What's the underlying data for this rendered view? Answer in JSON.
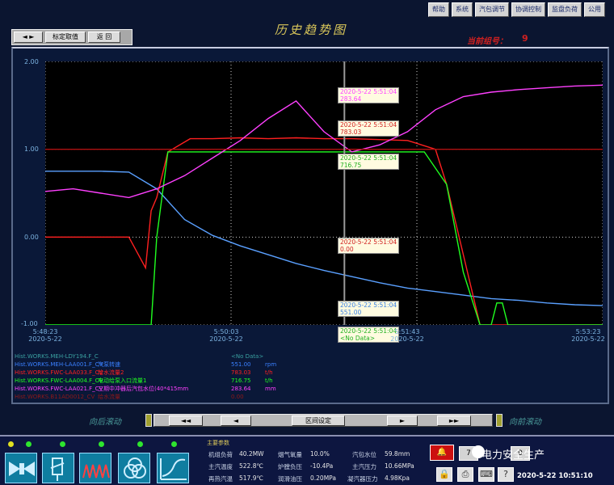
{
  "topnav": [
    "帮助",
    "系统",
    "汽包调节",
    "协调控制",
    "监盘负荷",
    "公用"
  ],
  "toolbar": {
    "nav": "◄ ►",
    "bookmark": "标定取值",
    "back": "返 回"
  },
  "title": "历史趋势图",
  "group": {
    "label": "当前组号：",
    "value": "9"
  },
  "chart_data": {
    "type": "line",
    "ylim": [
      -1.0,
      2.0
    ],
    "yticks": [
      "2.00",
      "1.00",
      "0.00",
      "-1.00"
    ],
    "xticks": [
      {
        "time": "5:48:23",
        "date": "2020-5-22"
      },
      {
        "time": "5:50:03",
        "date": "2020-5-22"
      },
      {
        "time": "5:51:43",
        "date": "2020-5-22"
      },
      {
        "time": "5:53:23",
        "date": "2020-5-22"
      }
    ],
    "cursor_time": "2020-5-22 5:51:04",
    "series": [
      {
        "name": "Hist.WORKS.MEH-LAA001.F_CV",
        "color": "#5aa0ff",
        "x": [
          0,
          0.05,
          0.1,
          0.15,
          0.2,
          0.25,
          0.3,
          0.35,
          0.4,
          0.45,
          0.5,
          0.55,
          0.6,
          0.65,
          0.7,
          0.75,
          0.8,
          0.85,
          0.9,
          0.95,
          1.0
        ],
        "y": [
          0.75,
          0.75,
          0.75,
          0.74,
          0.55,
          0.2,
          0.02,
          -0.1,
          -0.2,
          -0.3,
          -0.38,
          -0.45,
          -0.52,
          -0.58,
          -0.62,
          -0.66,
          -0.7,
          -0.72,
          -0.75,
          -0.77,
          -0.78
        ]
      },
      {
        "name": "Hist.WORKS.FWC-LAA033.F_CV",
        "color": "#ff2020",
        "x": [
          0,
          0.05,
          0.1,
          0.15,
          0.18,
          0.19,
          0.2,
          0.22,
          0.26,
          0.3,
          0.35,
          0.4,
          0.45,
          0.5,
          0.55,
          0.6,
          0.65,
          0.7,
          0.72,
          0.75,
          0.78,
          0.8,
          1.0
        ],
        "y": [
          0.0,
          0.0,
          0.0,
          0.0,
          -0.35,
          0.3,
          0.45,
          0.97,
          1.12,
          1.12,
          1.13,
          1.12,
          1.13,
          1.12,
          1.12,
          1.11,
          1.1,
          1.0,
          0.6,
          -0.2,
          -1.0,
          -1.0,
          -1.0
        ]
      },
      {
        "name": "Hist.WORKS.FWC-LAA004.F_CV",
        "color": "#20ff20",
        "x": [
          0,
          0.05,
          0.1,
          0.15,
          0.19,
          0.2,
          0.22,
          0.3,
          0.4,
          0.5,
          0.6,
          0.68,
          0.72,
          0.75,
          0.78,
          0.8,
          0.81,
          0.82,
          0.83,
          1.0
        ],
        "y": [
          -1.0,
          -1.0,
          -1.0,
          -1.0,
          -1.0,
          0.0,
          0.97,
          0.97,
          0.97,
          0.97,
          0.97,
          0.97,
          0.6,
          -0.4,
          -1.0,
          -1.0,
          -0.75,
          -0.75,
          -1.0,
          -1.0
        ]
      },
      {
        "name": "Hist.WORKS.FWC-LAA021.F_CV",
        "color": "#ff40ff",
        "x": [
          0,
          0.05,
          0.1,
          0.15,
          0.2,
          0.25,
          0.3,
          0.35,
          0.4,
          0.45,
          0.5,
          0.55,
          0.6,
          0.65,
          0.7,
          0.75,
          0.8,
          0.85,
          0.9,
          0.95,
          1.0
        ],
        "y": [
          0.52,
          0.55,
          0.5,
          0.45,
          0.55,
          0.7,
          0.9,
          1.1,
          1.35,
          1.55,
          1.2,
          0.97,
          1.05,
          1.2,
          1.45,
          1.6,
          1.65,
          1.68,
          1.7,
          1.72,
          1.73
        ]
      },
      {
        "name": "Hist.WORKS.Ref",
        "color": "#b01010",
        "x": [
          0,
          1.0
        ],
        "y": [
          1.0,
          1.0
        ]
      }
    ]
  },
  "callouts": [
    {
      "time": "2020-5-22 5:51:04",
      "value": "283.64",
      "color": "#ff40ff"
    },
    {
      "time": "2020-5-22 5:51:04",
      "value": "783.03",
      "color": "#d02020"
    },
    {
      "time": "2020-5-22 5:51:04",
      "value": "716.75",
      "color": "#20b020"
    },
    {
      "time": "2020-5-22 5:51:04",
      "value": "0.00",
      "color": "#d02020"
    },
    {
      "time": "2020-5-22 5:51:04",
      "value": "551.00",
      "color": "#3a80e0"
    },
    {
      "time": "2020-5-22 5:51:04",
      "value": "<No Data>",
      "color": "#20b020"
    }
  ],
  "legend": [
    {
      "tag": "Hist.WORKS.MEH-LDY194.F_C",
      "desc": "",
      "value": "<No Data>",
      "unit": "",
      "color": "#3aa0a0"
    },
    {
      "tag": "Hist.WORKS.MEH-LAA001.F_CV",
      "desc": "汽泵转速",
      "value": "551.00",
      "unit": "rpm",
      "color": "#3a80ff"
    },
    {
      "tag": "Hist.WORKS.FWC-LAA033.F_CV",
      "desc": "给水流量2",
      "value": "783.03",
      "unit": "t/h",
      "color": "#ff2020"
    },
    {
      "tag": "Hist.WORKS.FWC-LAA004.F_CV",
      "desc": "电动给泵入口流量1",
      "value": "716.75",
      "unit": "t/h",
      "color": "#20ff20"
    },
    {
      "tag": "Hist.WORKS.FWC-LAA021.F_CV",
      "desc": "三期中冲器后汽包水位(40*415mm",
      "value": "283.64",
      "unit": "mm",
      "color": "#ff40ff"
    },
    {
      "tag": "Hist.WORKS.B11AD0012_CV",
      "desc": "给水流量",
      "value": "0.00",
      "unit": "",
      "color": "#901818"
    }
  ],
  "scroll": {
    "back_label": "向后滚动",
    "fwd_label": "向前滚动",
    "fast_back": "◄◄",
    "back": "◄",
    "range": "区间设定",
    "fwd": "►",
    "fast_fwd": "►►"
  },
  "params": {
    "title": "主要参数",
    "rows": [
      [
        {
          "l": "机组负荷",
          "v": "40.2MW"
        },
        {
          "l": "烟气氧量",
          "v": "10.0%"
        },
        {
          "l": "汽包水位",
          "v": "59.8mm"
        }
      ],
      [
        {
          "l": "主汽温度",
          "v": "522.8℃"
        },
        {
          "l": "炉膛负压",
          "v": "-10.4Pa"
        },
        {
          "l": "主汽压力",
          "v": "10.66MPa"
        }
      ],
      [
        {
          "l": "再热汽温",
          "v": "517.9℃"
        },
        {
          "l": "润滑油压",
          "v": "0.20MPa"
        },
        {
          "l": "凝汽器压力",
          "v": "4.98Kpa"
        }
      ]
    ]
  },
  "alarm_button": "🔔",
  "sys_buttons": [
    "7",
    "0"
  ],
  "icons": [
    "lock-icon",
    "printer-icon",
    "keyboard-icon",
    "help-icon"
  ],
  "clock": "2020-5-22  10:51:10",
  "watermark": "电力安全生产"
}
